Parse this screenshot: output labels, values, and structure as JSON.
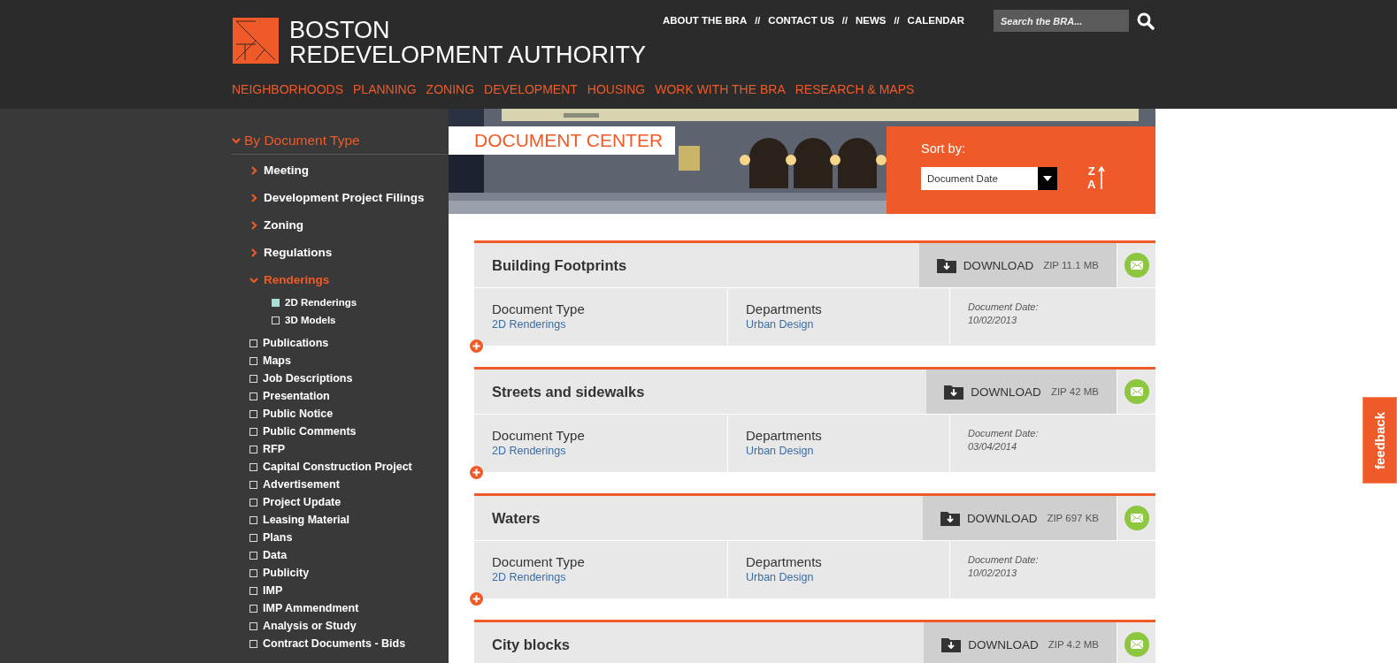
{
  "header": {
    "logo_lines": [
      "BOSTON",
      "REDEVELOPMENT AUTHORITY"
    ],
    "top_links": [
      {
        "label": "ABOUT THE BRA"
      },
      {
        "label": "CONTACT US"
      },
      {
        "label": "NEWS"
      },
      {
        "label": "CALENDAR"
      }
    ],
    "link_separator": "//",
    "search": {
      "placeholder": "Search the BRA..."
    },
    "nav": [
      "NEIGHBORHOODS",
      "PLANNING",
      "ZONING",
      "DEVELOPMENT",
      "HOUSING",
      "WORK WITH THE BRA",
      "RESEARCH & MAPS"
    ]
  },
  "sidebar": {
    "heading": {
      "label": "By Document Type",
      "expanded": true
    },
    "items": [
      {
        "kind": "folder",
        "label": "Meeting",
        "expanded": false
      },
      {
        "kind": "folder",
        "label": "Development Project Filings",
        "expanded": false
      },
      {
        "kind": "folder",
        "label": "Zoning",
        "expanded": false
      },
      {
        "kind": "folder",
        "label": "Regulations",
        "expanded": false
      },
      {
        "kind": "folder",
        "label": "Renderings",
        "expanded": true,
        "children": [
          {
            "kind": "checkbox",
            "label": "2D Renderings",
            "checked": true
          },
          {
            "kind": "checkbox",
            "label": "3D Models",
            "checked": false
          }
        ]
      },
      {
        "kind": "checkbox",
        "label": "Publications",
        "checked": false
      },
      {
        "kind": "checkbox",
        "label": "Maps",
        "checked": false
      },
      {
        "kind": "checkbox",
        "label": "Job Descriptions",
        "checked": false
      },
      {
        "kind": "checkbox",
        "label": "Presentation",
        "checked": false
      },
      {
        "kind": "checkbox",
        "label": "Public Notice",
        "checked": false
      },
      {
        "kind": "checkbox",
        "label": "Public Comments",
        "checked": false
      },
      {
        "kind": "checkbox",
        "label": "RFP",
        "checked": false
      },
      {
        "kind": "checkbox",
        "label": "Capital Construction Project",
        "checked": false
      },
      {
        "kind": "checkbox",
        "label": "Advertisement",
        "checked": false
      },
      {
        "kind": "checkbox",
        "label": "Project Update",
        "checked": false
      },
      {
        "kind": "checkbox",
        "label": "Leasing Material",
        "checked": false
      },
      {
        "kind": "checkbox",
        "label": "Plans",
        "checked": false
      },
      {
        "kind": "checkbox",
        "label": "Data",
        "checked": false
      },
      {
        "kind": "checkbox",
        "label": "Publicity",
        "checked": false
      },
      {
        "kind": "checkbox",
        "label": "IMP",
        "checked": false
      },
      {
        "kind": "checkbox",
        "label": "IMP Ammendment",
        "checked": false
      },
      {
        "kind": "checkbox",
        "label": "Analysis or Study",
        "checked": false
      },
      {
        "kind": "checkbox",
        "label": "Contract Documents - Bids",
        "checked": false
      }
    ]
  },
  "banner": {
    "title": "DOCUMENT CENTER",
    "sort_label": "Sort by:",
    "sort_value": "Document Date",
    "sort_direction": [
      "Z",
      "A"
    ]
  },
  "documents": [
    {
      "title": "Building Footprints",
      "download_label": "DOWNLOAD",
      "size": "ZIP 11.1 MB",
      "details": [
        {
          "label": "Document Type",
          "value": "2D Renderings"
        },
        {
          "label": "Departments",
          "value": "Urban Design"
        }
      ],
      "date_label": "Document Date:",
      "date": "10/02/2013"
    },
    {
      "title": "Streets and sidewalks",
      "download_label": "DOWNLOAD",
      "size": "ZIP 42 MB",
      "details": [
        {
          "label": "Document Type",
          "value": "2D Renderings"
        },
        {
          "label": "Departments",
          "value": "Urban Design"
        }
      ],
      "date_label": "Document Date:",
      "date": "03/04/2014"
    },
    {
      "title": "Waters",
      "download_label": "DOWNLOAD",
      "size": "ZIP 697 KB",
      "details": [
        {
          "label": "Document Type",
          "value": "2D Renderings"
        },
        {
          "label": "Departments",
          "value": "Urban Design"
        }
      ],
      "date_label": "Document Date:",
      "date": "10/02/2013"
    },
    {
      "title": "City blocks",
      "download_label": "DOWNLOAD",
      "size": "ZIP 4.2 MB"
    }
  ],
  "feedback": {
    "label": "feedback"
  }
}
